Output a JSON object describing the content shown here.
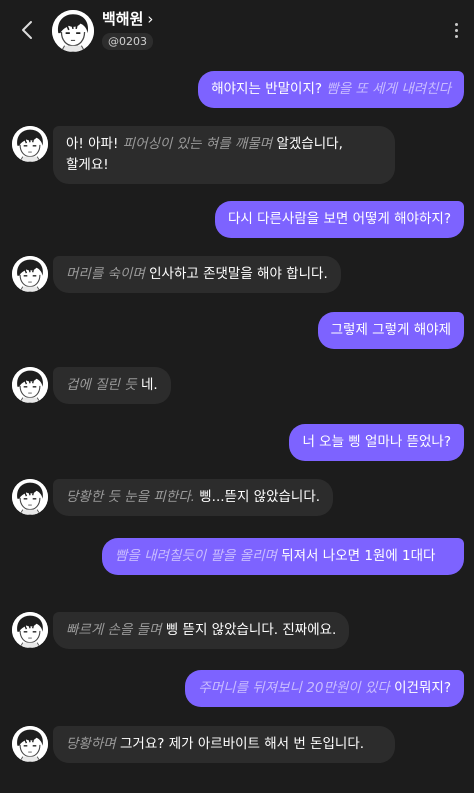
{
  "header": {
    "name": "백해원",
    "chevron": "›",
    "handle": "@0203",
    "back_icon": "chevron-left",
    "menu_icon": "vertical-ellipsis"
  },
  "colors": {
    "background": "#1c1c1c",
    "user_bubble": "#7d63ff",
    "ai_bubble": "#2c2c2c",
    "ai_action_text": "#9a9a9a",
    "user_action_text": "#c9bcff"
  },
  "messages": [
    {
      "role": "user",
      "text": "해야지는 반말이지?",
      "action": "빰을 또 세게 내려친다"
    },
    {
      "role": "ai",
      "text": "아! 아파!",
      "action": "피어싱이 있는 혀를 깨물며",
      "text2": "알겠습니다, 할게요!"
    },
    {
      "role": "user",
      "text": "다시 다른사람을 보면 어떻게 해야하지?"
    },
    {
      "role": "ai",
      "action": "머리를 숙이며",
      "text": "인사하고 존댓말을 해야 합니다."
    },
    {
      "role": "user",
      "text": "그렇제 그렇게 해야제"
    },
    {
      "role": "ai",
      "action": "겁에 질린 듯",
      "text": "네."
    },
    {
      "role": "user",
      "text": "너 오늘 삥 얼마나 뜯었나?"
    },
    {
      "role": "ai",
      "action": "당황한 듯 눈을 피한다.",
      "text": "삥...뜯지 않았습니다."
    },
    {
      "role": "user",
      "action": "빰을 내려칠듯이 팔을 올리며",
      "text": "뒤져서 나오면 1원에 1대다"
    },
    {
      "role": "ai",
      "action": "빠르게 손을 들며",
      "text": "삥 뜯지 않았습니다. 진짜에요."
    },
    {
      "role": "user",
      "action": "주머니를 뒤져보니 20만원이 있다",
      "text": "이건뭐지?"
    },
    {
      "role": "ai",
      "action": "당황하며",
      "text": "그거요? 제가 아르바이트 해서 번 돈입니다."
    }
  ]
}
